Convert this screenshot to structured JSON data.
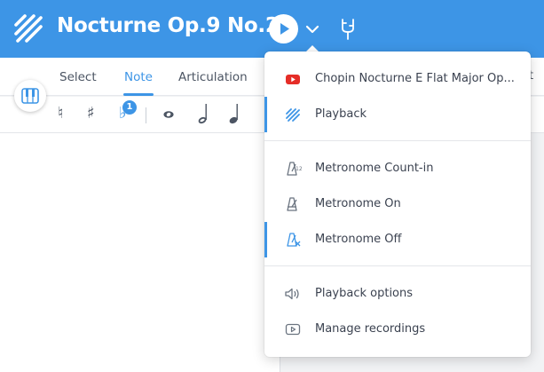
{
  "header": {
    "title": "Nocturne Op.9 No.2",
    "bg_color": "#3d95e6"
  },
  "tabs": [
    {
      "label": "Select",
      "active": false
    },
    {
      "label": "Note",
      "active": true
    },
    {
      "label": "Articulation",
      "active": false
    }
  ],
  "edge_tab_fragment": "t",
  "symbols": {
    "natural": "♮",
    "sharp": "♯",
    "flat": "♭",
    "flat_badge": "1",
    "whole_note": "𝅝",
    "half_note": "𝅗𝅥",
    "quarter_note": "𝅘𝅥"
  },
  "menu": {
    "items": [
      {
        "label": "Chopin Nocturne E Flat Major Op...",
        "icon": "youtube-icon",
        "selected": false
      },
      {
        "label": "Playback",
        "icon": "playback-icon",
        "selected": true
      },
      {
        "label": "Metronome Count-in",
        "icon": "metronome-count-in-icon",
        "selected": false
      },
      {
        "label": "Metronome On",
        "icon": "metronome-on-icon",
        "selected": false
      },
      {
        "label": "Metronome Off",
        "icon": "metronome-off-icon",
        "selected": true
      },
      {
        "label": "Playback options",
        "icon": "speaker-icon",
        "selected": false
      },
      {
        "label": "Manage recordings",
        "icon": "recording-icon",
        "selected": false
      }
    ]
  },
  "colors": {
    "accent": "#3d95e6",
    "youtube_red": "#e52d27",
    "icon_gray": "#6b7480"
  }
}
